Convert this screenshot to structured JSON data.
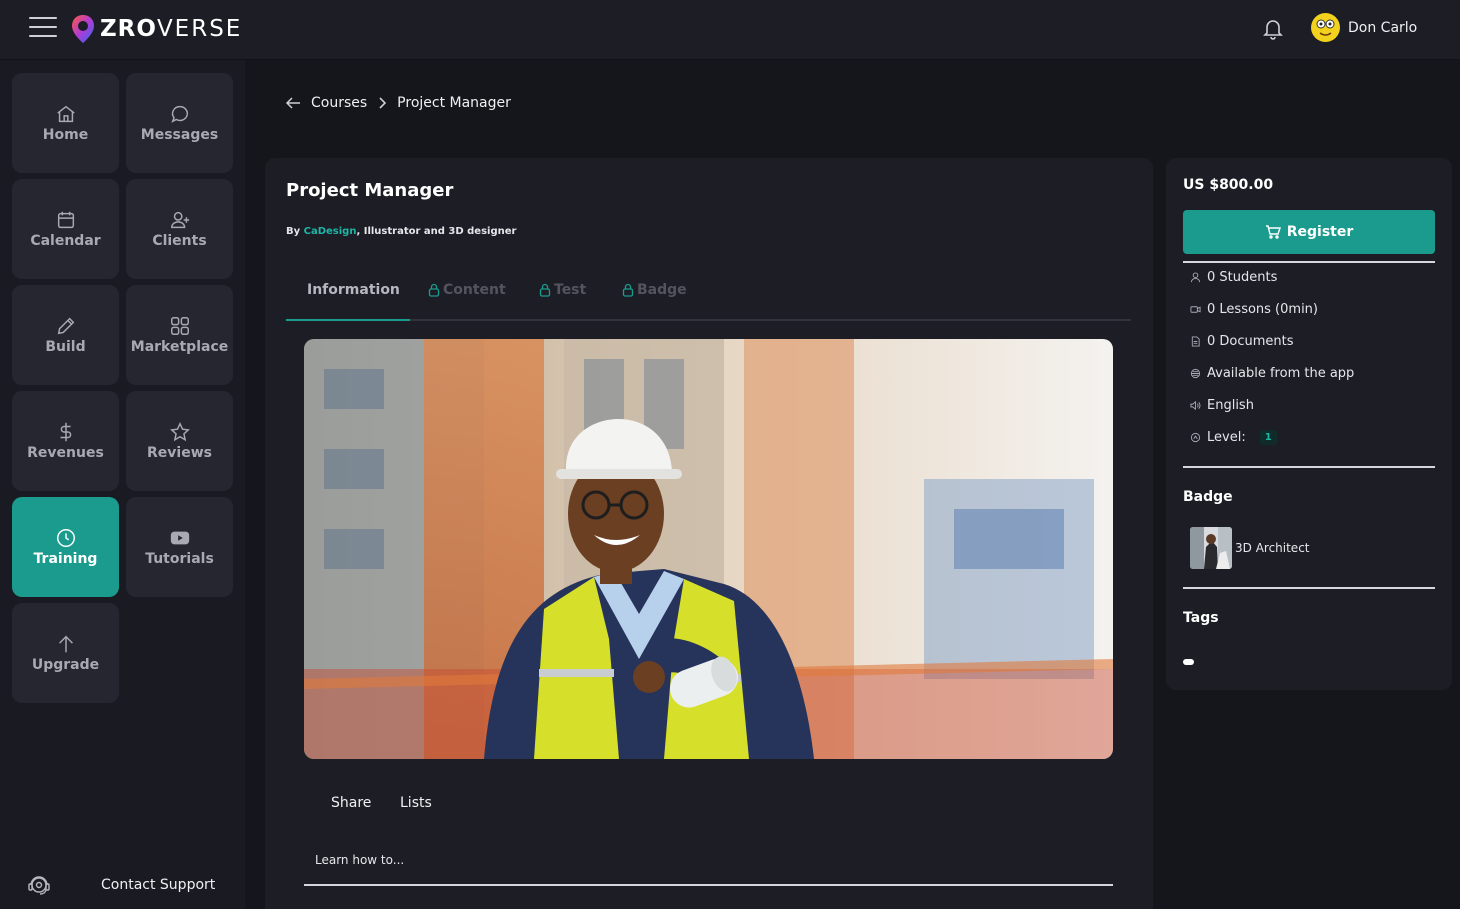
{
  "app": {
    "brand_bold": "ZRO",
    "brand_light": "VERSE"
  },
  "header": {
    "user_name": "Don Carlo"
  },
  "sidebar": {
    "items": [
      {
        "label": "Home",
        "icon": "home-icon"
      },
      {
        "label": "Messages",
        "icon": "chat-bubble-icon"
      },
      {
        "label": "Calendar",
        "icon": "calendar-icon"
      },
      {
        "label": "Clients",
        "icon": "user-add-icon"
      },
      {
        "label": "Build",
        "icon": "pencil-icon"
      },
      {
        "label": "Marketplace",
        "icon": "grid-icon"
      },
      {
        "label": "Revenues",
        "icon": "dollar-icon"
      },
      {
        "label": "Reviews",
        "icon": "star-icon"
      },
      {
        "label": "Training",
        "icon": "clock-icon",
        "active": true
      },
      {
        "label": "Tutorials",
        "icon": "play-icon"
      },
      {
        "label": "Upgrade",
        "icon": "arrow-up-icon"
      }
    ],
    "support_label": "Contact Support"
  },
  "breadcrumb": {
    "parent": "Courses",
    "current": "Project Manager"
  },
  "course": {
    "title": "Project Manager",
    "by_prefix": "By ",
    "author": "CaDesign",
    "author_suffix": ", Illustrator and 3D designer",
    "tabs": [
      "Information",
      "Content",
      "Test",
      "Badge"
    ],
    "active_tab": "Information",
    "actions": [
      "Share",
      "Lists"
    ],
    "learn_label": "Learn how to..."
  },
  "details": {
    "price": "US $800.00",
    "register_label": "Register",
    "meta": [
      {
        "icon": "person-icon",
        "text": "0 Students"
      },
      {
        "icon": "video-icon",
        "text": "0 Lessons (0min)"
      },
      {
        "icon": "document-icon",
        "text": "0 Documents"
      },
      {
        "icon": "app-icon",
        "text": "Available from the app"
      },
      {
        "icon": "speaker-icon",
        "text": "English"
      },
      {
        "icon": "level-icon",
        "text": "Level:"
      }
    ],
    "level_value": "1",
    "badge_title": "Badge",
    "badge_name": "3D Architect",
    "tags_title": "Tags"
  },
  "colors": {
    "accent": "#1b9b8e",
    "background": "#15151c",
    "panel": "#1d1d26",
    "tile": "#262631"
  }
}
